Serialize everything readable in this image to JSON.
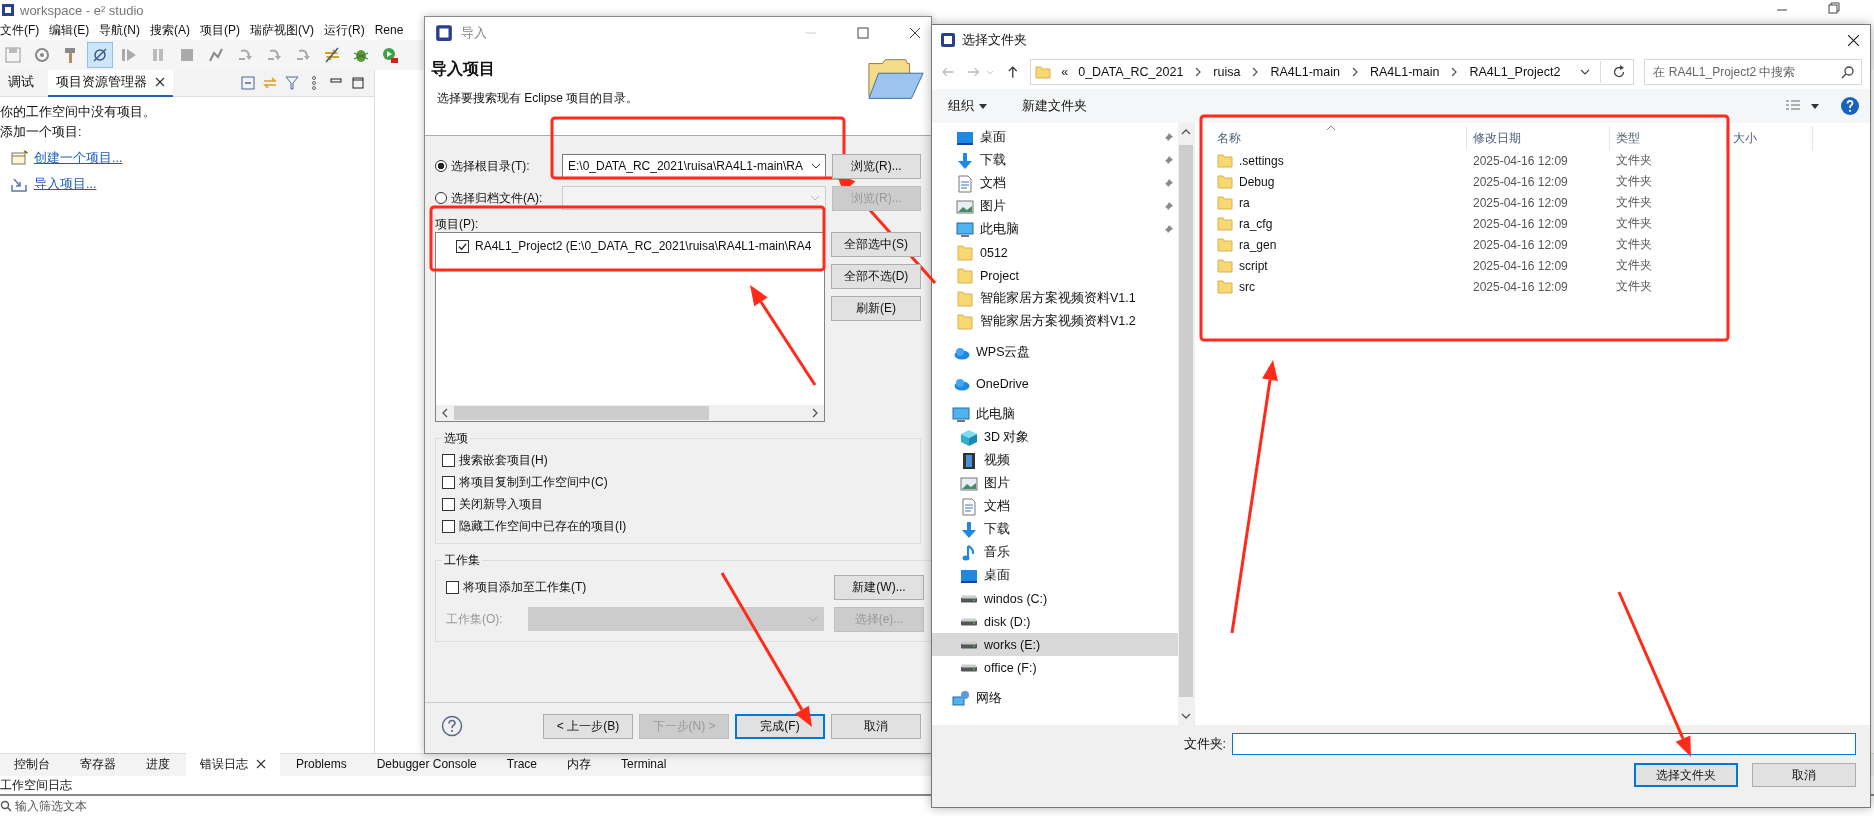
{
  "ide": {
    "title": "workspace - e² studio",
    "menu": [
      "文件(F)",
      "编辑(E)",
      "导航(N)",
      "搜索(A)",
      "项目(P)",
      "瑞萨视图(V)",
      "运行(R)",
      "Rene"
    ],
    "toolbar": [
      {
        "kind": "save",
        "pressed": false
      },
      {
        "kind": "gear",
        "pressed": false
      },
      {
        "kind": "hammer",
        "pressed": false
      },
      {
        "kind": "skip",
        "pressed": true
      },
      {
        "kind": "resume",
        "pressed": false
      },
      {
        "kind": "suspend",
        "pressed": false
      },
      {
        "kind": "stop",
        "pressed": false
      },
      {
        "kind": "connect",
        "pressed": false
      },
      {
        "kind": "step",
        "pressed": false
      },
      {
        "kind": "step",
        "pressed": false
      },
      {
        "kind": "step",
        "pressed": false
      },
      {
        "kind": "sync",
        "pressed": false
      },
      {
        "kind": "bug",
        "pressed": false
      },
      {
        "kind": "run",
        "pressed": false
      }
    ],
    "panel_tabs": [
      {
        "label": "调试",
        "selected": false
      },
      {
        "label": "项目资源管理器",
        "selected": true
      }
    ],
    "empty_message": "你的工作空间中没有项目。",
    "add_prompt": "添加一个项目:",
    "links": [
      {
        "kind": "create",
        "label": "创建一个项目..."
      },
      {
        "kind": "import",
        "label": "导入项目..."
      }
    ],
    "bottom_tabs": [
      {
        "label": "控制台",
        "selected": false
      },
      {
        "label": "寄存器",
        "selected": false
      },
      {
        "label": "进度",
        "selected": false
      },
      {
        "label": "错误日志",
        "selected": true
      },
      {
        "label": "Problems",
        "selected": false
      },
      {
        "label": "Debugger Console",
        "selected": false
      },
      {
        "label": "Trace",
        "selected": false
      },
      {
        "label": "内存",
        "selected": false
      },
      {
        "label": "Terminal",
        "selected": false
      }
    ],
    "log_title": "工作空间日志",
    "filter_placeholder": "输入筛选文本"
  },
  "import_dialog": {
    "title": "导入",
    "heading": "导入项目",
    "description": "选择要搜索现有 Eclipse 项目的目录。",
    "sources": [
      {
        "label": "选择根目录(T):",
        "selected": true,
        "value": "E:\\0_DATA_RC_2021\\ruisa\\RA4L1-main\\RA",
        "button": "浏览(R)..."
      },
      {
        "label": "选择归档文件(A):",
        "selected": false,
        "button": "浏览(R)..."
      }
    ],
    "projects_label": "项目(P):",
    "projects": [
      {
        "label": "RA4L1_Project2  (E:\\0_DATA_RC_2021\\ruisa\\RA4L1-main\\RA4",
        "checked": true
      }
    ],
    "project_buttons": [
      "全部选中(S)",
      "全部不选(D)",
      "刷新(E)"
    ],
    "options_title": "选项",
    "options": [
      {
        "label": "搜索嵌套项目(H)",
        "checked": false
      },
      {
        "label": "将项目复制到工作空间中(C)",
        "checked": false
      },
      {
        "label": "关闭新导入项目",
        "checked": false
      },
      {
        "label": "隐藏工作空间中已存在的项目(I)",
        "checked": false
      }
    ],
    "working_set_title": "工作集",
    "working_set_add": {
      "label": "将项目添加至工作集(T)",
      "checked": false
    },
    "working_set_new": "新建(W)...",
    "working_set_label": "工作集(O):",
    "working_set_select": "选择(e)...",
    "buttons": [
      {
        "label": "< 上一步(B)",
        "disabled": false,
        "default": false
      },
      {
        "label": "下一步(N) >",
        "disabled": true,
        "default": false
      },
      {
        "label": "完成(F)",
        "disabled": false,
        "default": true
      },
      {
        "label": "取消",
        "disabled": false,
        "default": false
      }
    ]
  },
  "folder_dialog": {
    "title": "选择文件夹",
    "path_overflow": "«",
    "path": [
      "0_DATA_RC_2021",
      "ruisa",
      "RA4L1-main",
      "RA4L1-main",
      "RA4L1_Project2"
    ],
    "search_placeholder": "在 RA4L1_Project2 中搜索",
    "organize": "组织",
    "new_folder": "新建文件夹",
    "nav": [
      {
        "label": "桌面",
        "kind": "desktop",
        "pinned": true,
        "selected": false
      },
      {
        "label": "下载",
        "kind": "download",
        "pinned": true,
        "selected": false
      },
      {
        "label": "文档",
        "kind": "document",
        "pinned": true,
        "selected": false
      },
      {
        "label": "图片",
        "kind": "picture",
        "pinned": true,
        "selected": false
      },
      {
        "label": "此电脑",
        "kind": "computer",
        "pinned": true,
        "selected": false
      },
      {
        "label": "0512",
        "kind": "folder",
        "pinned": false,
        "selected": false
      },
      {
        "label": "Project",
        "kind": "folder",
        "pinned": false,
        "selected": false
      },
      {
        "label": "智能家居方案视频资料V1.1",
        "kind": "folder",
        "pinned": false,
        "selected": false
      },
      {
        "label": "智能家居方案视频资料V1.2",
        "kind": "folder",
        "pinned": false,
        "selected": false
      },
      {
        "label": "WPS云盘",
        "kind": "cloud",
        "pinned": false,
        "selected": false
      },
      {
        "label": "OneDrive",
        "kind": "cloud",
        "pinned": false,
        "selected": false
      },
      {
        "label": "此电脑",
        "kind": "computer",
        "pinned": false,
        "selected": false,
        "children": [
          {
            "label": "3D 对象",
            "kind": "cube",
            "pinned": false,
            "selected": false
          },
          {
            "label": "视频",
            "kind": "video",
            "pinned": false,
            "selected": false
          },
          {
            "label": "图片",
            "kind": "picture",
            "pinned": false,
            "selected": false
          },
          {
            "label": "文档",
            "kind": "document",
            "pinned": false,
            "selected": false
          },
          {
            "label": "下载",
            "kind": "download",
            "pinned": false,
            "selected": false
          },
          {
            "label": "音乐",
            "kind": "music",
            "pinned": false,
            "selected": false
          },
          {
            "label": "桌面",
            "kind": "desktop",
            "pinned": false,
            "selected": false
          },
          {
            "label": "windos (C:)",
            "kind": "drive",
            "pinned": false,
            "selected": false
          },
          {
            "label": "disk (D:)",
            "kind": "drive",
            "pinned": false,
            "selected": false
          },
          {
            "label": "works (E:)",
            "kind": "drive",
            "pinned": false,
            "selected": true
          },
          {
            "label": "office (F:)",
            "kind": "drive",
            "pinned": false,
            "selected": false
          }
        ]
      },
      {
        "label": "网络",
        "kind": "network",
        "pinned": false,
        "selected": false
      }
    ],
    "columns": [
      "名称",
      "修改日期",
      "类型",
      "大小"
    ],
    "rows": [
      {
        "name": ".settings",
        "date": "2025-04-16 12:09",
        "type": "文件夹"
      },
      {
        "name": "Debug",
        "date": "2025-04-16 12:09",
        "type": "文件夹"
      },
      {
        "name": "ra",
        "date": "2025-04-16 12:09",
        "type": "文件夹"
      },
      {
        "name": "ra_cfg",
        "date": "2025-04-16 12:09",
        "type": "文件夹"
      },
      {
        "name": "ra_gen",
        "date": "2025-04-16 12:09",
        "type": "文件夹"
      },
      {
        "name": "script",
        "date": "2025-04-16 12:09",
        "type": "文件夹"
      },
      {
        "name": "src",
        "date": "2025-04-16 12:09",
        "type": "文件夹"
      }
    ],
    "folder_label": "文件夹:",
    "buttons": [
      {
        "label": "选择文件夹",
        "default": true
      },
      {
        "label": "取消",
        "default": false
      }
    ]
  }
}
